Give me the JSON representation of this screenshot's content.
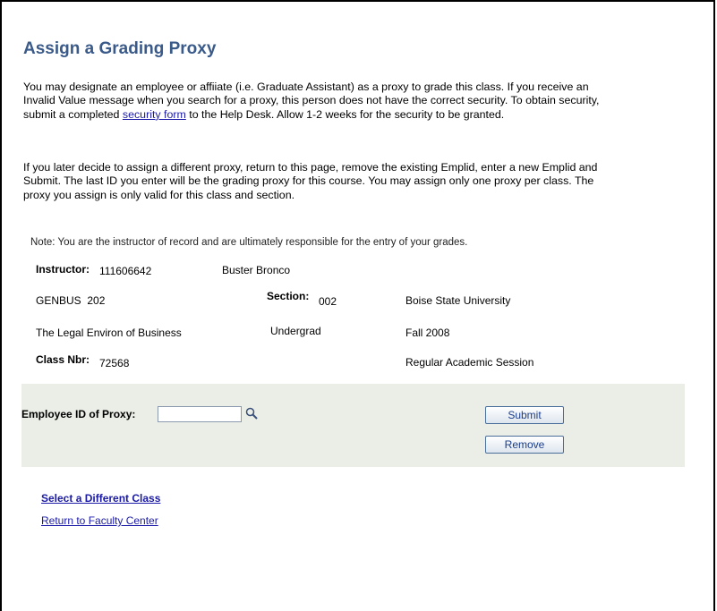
{
  "page": {
    "title": "Assign a Grading Proxy"
  },
  "intro": {
    "p1_before": "You may designate an employee or affiiate (i.e. Graduate Assistant) as a proxy to grade this class. If you receive an Invalid Value message when you search for a proxy, this person does not have the correct security. To obtain security, submit a completed ",
    "p1_link": "security form",
    "p1_after": " to the Help Desk. Allow 1-2 weeks for the security to be granted.",
    "p2": "If you later decide to assign a different proxy, return to this page, remove the existing Emplid, enter a new Emplid and Submit. The last ID you enter will be the grading proxy for this course. You may assign only one proxy per class. The proxy you assign is only valid for this class and section."
  },
  "note": "Note: You are the instructor of record and are ultimately responsible for the entry of your grades.",
  "class_info": {
    "instructor_label": "Instructor:",
    "instructor_id": "111606642",
    "instructor_name": "Buster Bronco",
    "course": "GENBUS  202",
    "section_label": "Section:",
    "section": "002",
    "institution": "Boise State University",
    "course_title": "The Legal Environ of Business",
    "career": "Undergrad",
    "term": "Fall 2008",
    "class_nbr_label": "Class Nbr:",
    "class_nbr": "72568",
    "session": "Regular Academic Session"
  },
  "proxy": {
    "label": "Employee ID of Proxy:",
    "value": "",
    "submit_label": "Submit",
    "remove_label": "Remove"
  },
  "links": {
    "select_class": "Select a Different Class",
    "return_center": "Return to Faculty Center"
  }
}
